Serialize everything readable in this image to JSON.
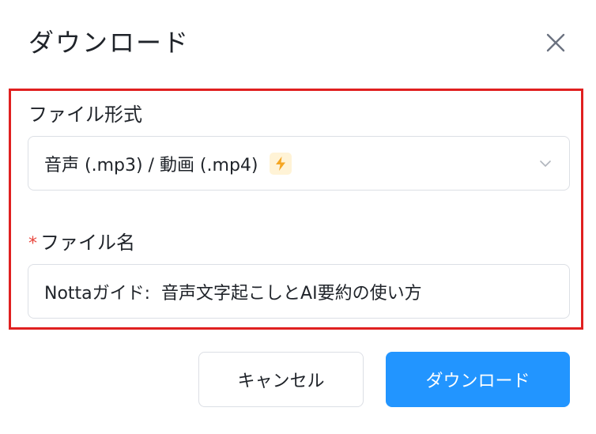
{
  "dialog": {
    "title": "ダウンロード",
    "close_icon": "close-icon"
  },
  "form": {
    "format_label": "ファイル形式",
    "format_value": "音声 (.mp3) / 動画 (.mp4)",
    "format_badge_icon": "lightning-bolt-icon",
    "format_dropdown_icon": "chevron-down-icon",
    "required_mark": "*",
    "filename_label": "ファイル名",
    "filename_value": "Nottaガイド:  音声文字起こしとAI要約の使い方"
  },
  "actions": {
    "cancel_label": "キャンセル",
    "download_label": "ダウンロード"
  },
  "colors": {
    "primary": "#2295ff",
    "highlight_border": "#e02020",
    "required": "#e8453c",
    "badge_bg": "#fff3d6",
    "badge_icon": "#f5a623"
  }
}
